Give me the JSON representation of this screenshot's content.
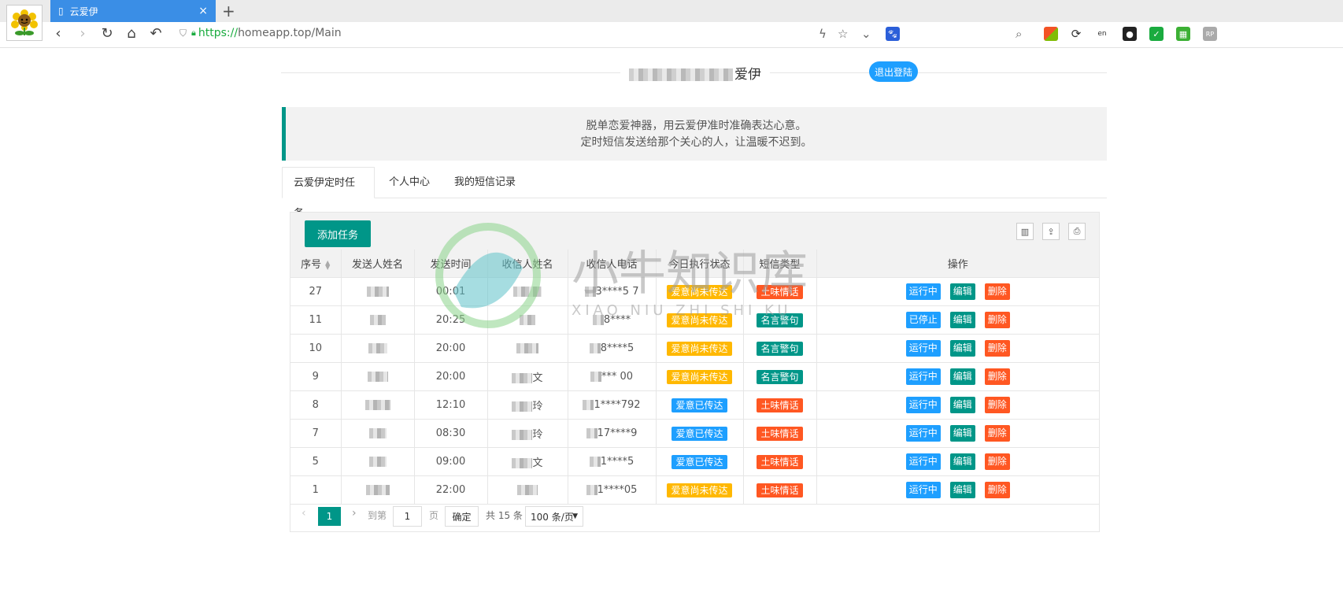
{
  "browser": {
    "tab_title": "云爱伊",
    "url_scheme": "https://",
    "url_rest": "homeapp.top/Main"
  },
  "header": {
    "site_title_suffix": "爱伊",
    "logout_label": "退出登陆"
  },
  "notice": {
    "line1": "脱单恋爱神器，用云爱伊准时准确表达心意。",
    "line2": "定时短信发送给那个关心的人，让温暖不迟到。"
  },
  "tabs": [
    "云爱伊定时任务",
    "个人中心",
    "我的短信记录"
  ],
  "toolbar": {
    "add_label": "添加任务"
  },
  "table": {
    "columns": [
      "序号",
      "发送人姓名",
      "发送时间",
      "收信人姓名",
      "收信人电话",
      "今日执行状态",
      "短信类型",
      "操作"
    ],
    "rows": [
      {
        "id": "27",
        "time": "00:01",
        "recv_name_visible": "",
        "phone_visible": "3****5  7",
        "status": "爱意尚未传达",
        "type": "土味情话",
        "run": "运行中"
      },
      {
        "id": "11",
        "time": "20:25",
        "recv_name_visible": "",
        "phone_visible": "8****",
        "status": "爱意尚未传达",
        "type": "名言警句",
        "run": "已停止"
      },
      {
        "id": "10",
        "time": "20:00",
        "recv_name_visible": "",
        "phone_visible": "8****5",
        "status": "爱意尚未传达",
        "type": "名言警句",
        "run": "运行中"
      },
      {
        "id": "9",
        "time": "20:00",
        "recv_name_visible": "文",
        "phone_visible": "***  00",
        "status": "爱意尚未传达",
        "type": "名言警句",
        "run": "运行中"
      },
      {
        "id": "8",
        "time": "12:10",
        "recv_name_visible": "玲",
        "phone_visible": "1****792",
        "status": "爱意已传达",
        "type": "土味情话",
        "run": "运行中"
      },
      {
        "id": "7",
        "time": "08:30",
        "recv_name_visible": "玲",
        "phone_visible": "17****9",
        "status": "爱意已传达",
        "type": "土味情话",
        "run": "运行中"
      },
      {
        "id": "5",
        "time": "09:00",
        "recv_name_visible": "文",
        "phone_visible": "1****5",
        "status": "爱意已传达",
        "type": "土味情话",
        "run": "运行中"
      },
      {
        "id": "1",
        "time": "22:00",
        "recv_name_visible": "",
        "phone_visible": "1****05",
        "status": "爱意尚未传达",
        "type": "土味情话",
        "run": "运行中"
      }
    ],
    "edit_label": "编辑",
    "delete_label": "删除"
  },
  "pager": {
    "current": "1",
    "goto_label": "到第",
    "page_input": "1",
    "page_label": "页",
    "confirm_label": "确定",
    "total_label": "共 15 条",
    "page_size": "100 条/页"
  },
  "watermark": {
    "cn": "小牛知识库",
    "en": "XIAO NIU ZHI SHI KU"
  },
  "colors": {
    "primary": "#009688",
    "blue": "#1e9fff",
    "orange": "#ffb800",
    "red": "#ff5722"
  }
}
